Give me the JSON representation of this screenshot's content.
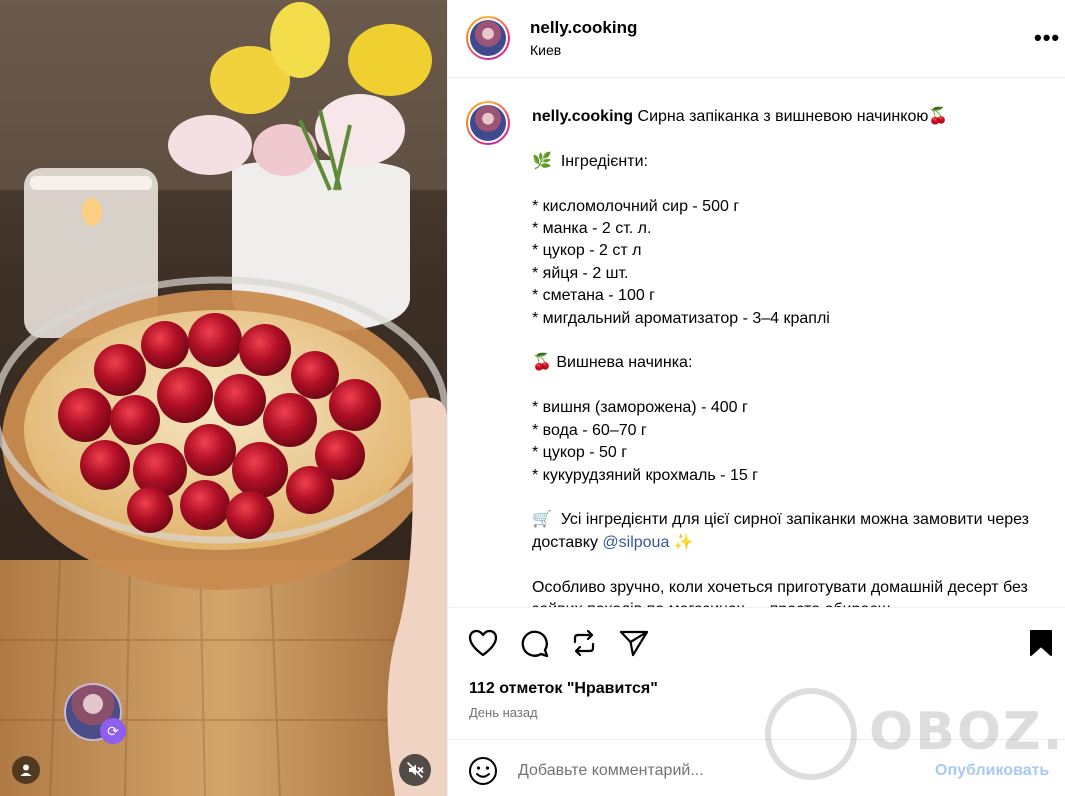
{
  "post": {
    "username": "nelly.cooking",
    "location": "Киев",
    "more_glyph": "•••",
    "caption_title": "Сирна запіканка з вишневою начинкою🍒",
    "caption_lines": [
      "",
      "🌿  Інгредієнти:",
      "",
      "* кисломолочний сир - 500 г",
      "* манка - 2 ст. л.",
      "* цукор - 2 ст л",
      "* яйця - 2 шт.",
      "* сметана - 100 г",
      "* мигдальний ароматизатор - 3–4 краплі",
      "",
      "🍒 Вишнева начинка:",
      "",
      "* вишня (заморожена) - 400 г",
      "* вода - 60–70 г",
      "* цукор - 50 г",
      "* кукурудзяний крохмаль - 15 г",
      ""
    ],
    "order_text_before": "🛒  Усі інгредієнти для цієї сирної запіканки можна замовити через доставку ",
    "order_mention": "@silpoua",
    "order_text_after": " ✨",
    "extra_text": "Особливо зручно, коли хочеться приготувати домашній десерт без зайвих походів по магазинах — просто обираєш"
  },
  "engagement": {
    "likes": "112 отметок \"Нравится\"",
    "date": "День назад"
  },
  "comment": {
    "placeholder": "Добавьте комментарий...",
    "publish_label": "Опубликовать"
  },
  "watermark": {
    "text": "OBOZ.UA"
  },
  "icons": {
    "like": "heart-icon",
    "comment": "comment-icon",
    "repost": "repost-icon",
    "share": "share-icon",
    "save": "bookmark-icon",
    "emoji": "emoji-icon",
    "more": "more-icon",
    "mute": "mute-icon",
    "user": "user-icon",
    "remix": "remix-icon"
  },
  "colors": {
    "link": "#385898",
    "publish_disabled": "#a9c9f2",
    "secondary_text": "#737373"
  }
}
